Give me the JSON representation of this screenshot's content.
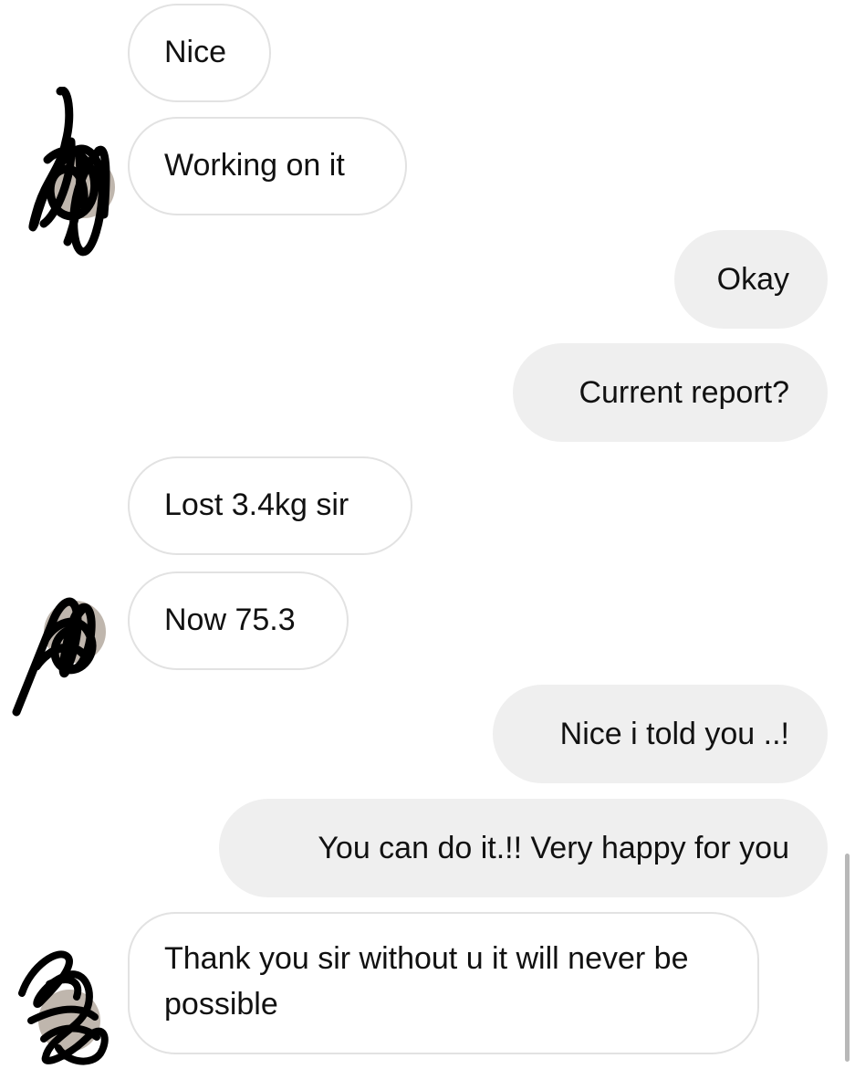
{
  "messages": [
    {
      "id": "m1",
      "direction": "incoming",
      "text": "Nice"
    },
    {
      "id": "m2",
      "direction": "incoming",
      "text": "Working on it"
    },
    {
      "id": "m3",
      "direction": "outgoing",
      "text": "Okay"
    },
    {
      "id": "m4",
      "direction": "outgoing",
      "text": "Current report?"
    },
    {
      "id": "m5",
      "direction": "incoming",
      "text": "Lost 3.4kg sir"
    },
    {
      "id": "m6",
      "direction": "incoming",
      "text": "Now 75.3"
    },
    {
      "id": "m7",
      "direction": "outgoing",
      "text": "Nice i told you ..!"
    },
    {
      "id": "m8",
      "direction": "outgoing",
      "text": "You can do it.!! Very happy for you"
    },
    {
      "id": "m9",
      "direction": "incoming",
      "text": "Thank you sir without u it will never be possible"
    }
  ],
  "colors": {
    "incoming_bubble_bg": "#ffffff",
    "incoming_bubble_border": "#e2e2e2",
    "outgoing_bubble_bg": "#efefef",
    "text": "#111111",
    "redaction_scribble": "#000000"
  },
  "icons": {
    "avatar": "redacted-avatar-icon"
  }
}
